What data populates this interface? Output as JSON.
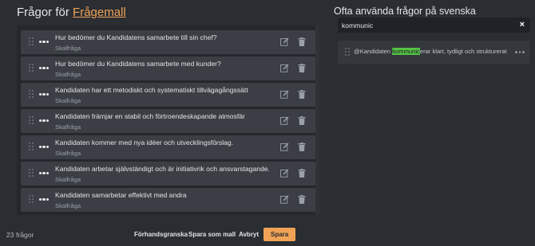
{
  "header": {
    "title_prefix": "Frågor för",
    "title_link": "Frågemall",
    "right_title": "Ofta använda frågor på svenska"
  },
  "questions": [
    {
      "text": "Hur bedömer du Kandidatens samarbete till sin chef?",
      "type": "Skalfråga"
    },
    {
      "text": "Hur bedömer du Kandidatens samarbete med kunder?",
      "type": "Skalfråga"
    },
    {
      "text": "Kandidaten har ett metodiskt och systematiskt tillvägagångssätt",
      "type": "Skalfråga"
    },
    {
      "text": "Kandidaten främjar en stabil och förtroendeskapande atmosfär",
      "type": "Skalfråga"
    },
    {
      "text": "Kandidaten kommer med nya idéer och utvecklingsförslag.",
      "type": "Skalfråga"
    },
    {
      "text": "Kandidaten arbetar självständigt och är initiativrik och ansvarstagande.",
      "type": "Skalfråga"
    },
    {
      "text": "Kandidaten samarbetar effektivt med andra",
      "type": "Skalfråga"
    }
  ],
  "search": {
    "value": "kommunic",
    "clear_label": "×"
  },
  "result": {
    "before": "@Kandidaten ",
    "highlight": "kommunic",
    "after": "erar klart, tydligt och strukturerat"
  },
  "footer": {
    "count": "23 frågor",
    "preview_label": "Förhandsgranska",
    "save_template_label": "Spara som mall",
    "cancel_label": "Avbryt",
    "save_label": "Spara"
  },
  "colors": {
    "accent": "#f0a356",
    "highlight": "#55c245",
    "background": "#2a2d32"
  },
  "icons": {
    "drag": "drag-handle-icon",
    "more": "more-dots-icon",
    "edit": "edit-icon",
    "delete": "trash-icon",
    "clear": "close-icon"
  }
}
